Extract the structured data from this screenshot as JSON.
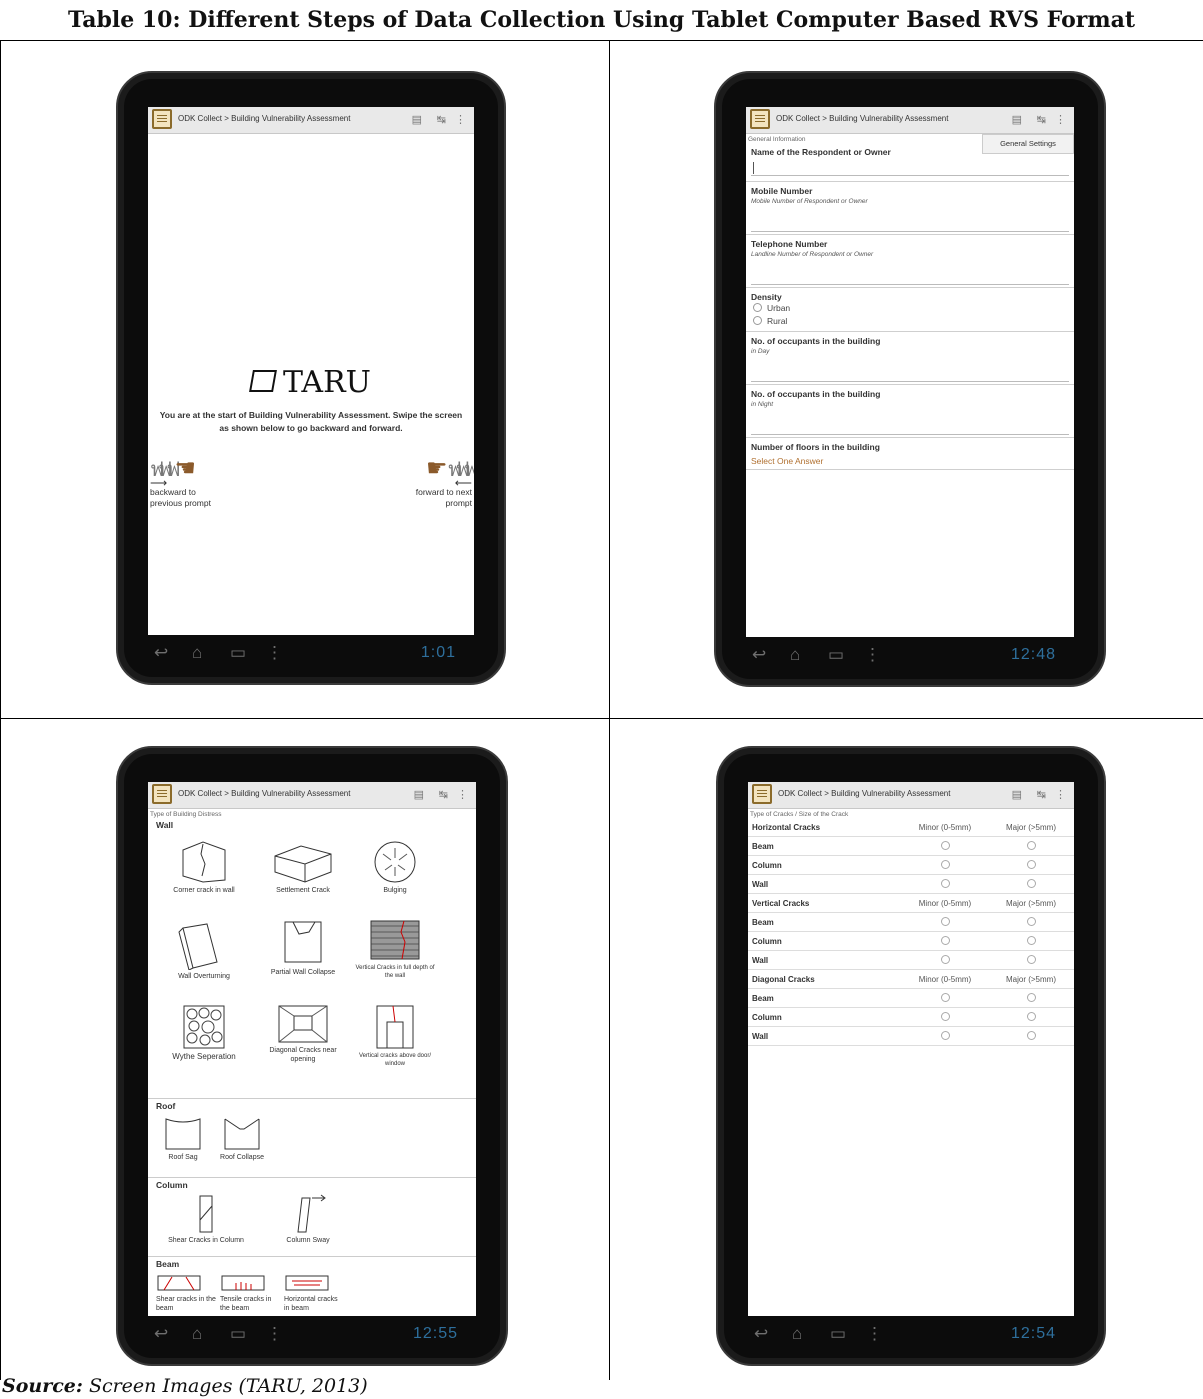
{
  "document": {
    "title": "Table 10: Different Steps of Data Collection Using Tablet Computer Based RVS Format",
    "source_label": "Source:",
    "source_text": "Screen Images (TARU, 2013)"
  },
  "app": {
    "title": "ODK Collect > Building Vulnerability Assessment"
  },
  "tablet1": {
    "clock": "1:01",
    "logo": "TARU",
    "intro": "You are at the start of Building Vulnerability Assessment. Swipe the screen as shown below to go backward and forward.",
    "backward": "backward to previous prompt",
    "forward": "forward to next prompt"
  },
  "tablet2": {
    "clock": "12:48",
    "section": "General Information",
    "menu_item": "General Settings",
    "fields": {
      "name": "Name of the Respondent or Owner",
      "mobile": "Mobile Number",
      "mobile_hint": "Mobile Number of Respondent or Owner",
      "phone": "Telephone Number",
      "phone_hint": "Landline Number of Respondent or Owner",
      "density": "Density",
      "urban": "Urban",
      "rural": "Rural",
      "occ_day": "No. of occupants in the building",
      "occ_day_hint": "in Day",
      "occ_night": "No. of occupants in the building",
      "occ_night_hint": "in Night",
      "floors": "Number of floors in the building",
      "floors_select": "Select One Answer"
    }
  },
  "tablet3": {
    "clock": "12:55",
    "section": "Type of Building Distress",
    "wall": "Wall",
    "roof": "Roof",
    "column": "Column",
    "beam": "Beam",
    "items": {
      "corner": "Corner crack in wall",
      "settlement": "Settlement Crack",
      "bulging": "Bulging",
      "overturning": "Wall Overturning",
      "partial": "Partial Wall Collapse",
      "vertical_full": "Vertical Cracks in full depth of the wall",
      "wythe": "Wythe Seperation",
      "diagonal": "Diagonal Cracks near opening",
      "vertical_door": "Vertical cracks above door/ window",
      "roof_sag": "Roof Sag",
      "roof_collapse": "Roof Collapse",
      "shear_column": "Shear Cracks in Column",
      "column_sway": "Column Sway",
      "shear_beam": "Shear cracks in the beam",
      "tensile_beam": "Tensile cracks in the beam",
      "horizontal_beam": "Horizontal cracks in beam"
    }
  },
  "tablet4": {
    "clock": "12:54",
    "section": "Type of Cracks / Size of the Crack",
    "minor": "Minor (0-5mm)",
    "major": "Major (>5mm)",
    "groups": [
      {
        "name": "Horizontal Cracks",
        "rows": [
          "Beam",
          "Column",
          "Wall"
        ]
      },
      {
        "name": "Vertical Cracks",
        "rows": [
          "Beam",
          "Column",
          "Wall"
        ]
      },
      {
        "name": "Diagonal Cracks",
        "rows": [
          "Beam",
          "Column",
          "Wall"
        ]
      }
    ]
  }
}
